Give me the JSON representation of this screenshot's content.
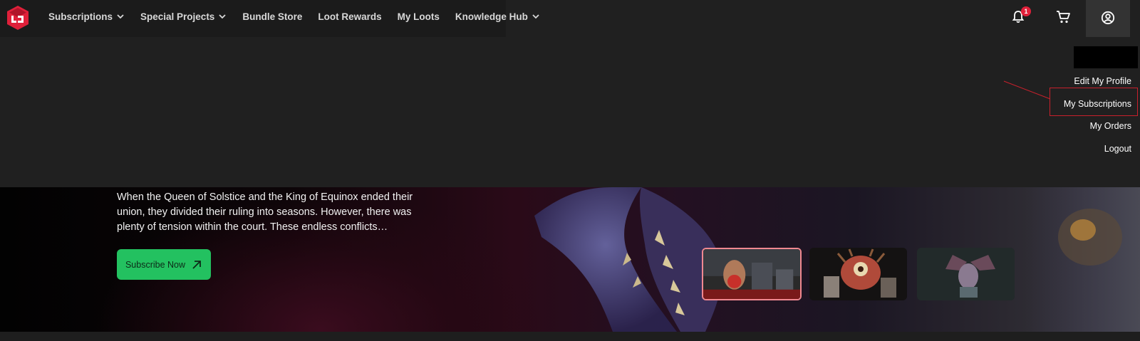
{
  "nav": {
    "items": [
      {
        "label": "Subscriptions",
        "has_dropdown": true
      },
      {
        "label": "Special Projects",
        "has_dropdown": true
      },
      {
        "label": "Bundle Store",
        "has_dropdown": false
      },
      {
        "label": "Loot Rewards",
        "has_dropdown": false
      },
      {
        "label": "My Loots",
        "has_dropdown": false
      },
      {
        "label": "Knowledge Hub",
        "has_dropdown": true
      }
    ],
    "notification_count": "1",
    "icons": {
      "logo": "studio-logo-icon",
      "bell": "bell-icon",
      "cart": "cart-icon",
      "account": "user-circle-icon"
    }
  },
  "account_menu": {
    "items": [
      "Edit My Profile",
      "My Subscriptions",
      "My Orders",
      "Logout"
    ]
  },
  "hero": {
    "description": "When the Queen of Solstice and the King of Equinox ended their union, they divided their ruling into seasons. However, there was plenty of tension within the court. These endless conflicts…",
    "cta_label": "Subscribe Now"
  },
  "colors": {
    "accent_green": "#23c160",
    "badge_red": "#e0203a",
    "highlight_red": "#c8202c",
    "logo_red": "#e0203a"
  }
}
